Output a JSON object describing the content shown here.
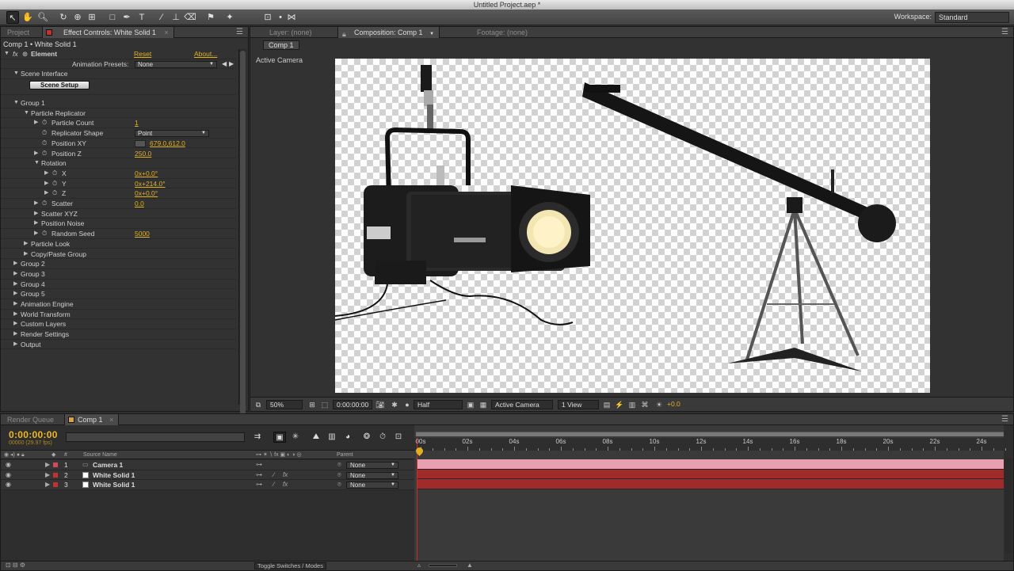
{
  "window": {
    "title": "Untitled Project.aep *"
  },
  "toolbar": {
    "workspace_label": "Workspace:",
    "workspace_value": "Standard"
  },
  "left_panel": {
    "tabs": [
      {
        "label": "Project"
      },
      {
        "label": "Effect Controls: White Solid 1"
      }
    ],
    "subtitle": "Comp 1 • White Solid 1",
    "effect": {
      "fx": "fx",
      "name": "Element",
      "reset": "Reset",
      "about": "About..."
    },
    "animation_presets": {
      "label": "Animation Presets:",
      "value": "None"
    },
    "scene_interface": "Scene Interface",
    "scene_setup": "Scene Setup",
    "tree": [
      {
        "label": "Group 1"
      },
      {
        "label": "Particle Replicator"
      },
      {
        "label": "Particle Count",
        "value": "1"
      },
      {
        "label": "Replicator Shape",
        "value": "Point"
      },
      {
        "label": "Position XY",
        "value": "679.0,612.0"
      },
      {
        "label": "Position Z",
        "value": "250.0"
      },
      {
        "label": "Rotation"
      },
      {
        "label": "X",
        "value": "0x+0.0°"
      },
      {
        "label": "Y",
        "value": "0x+214.0°"
      },
      {
        "label": "Z",
        "value": "0x+0.0°"
      },
      {
        "label": "Scatter",
        "value": "0.0"
      },
      {
        "label": "Scatter XYZ"
      },
      {
        "label": "Position Noise"
      },
      {
        "label": "Random Seed",
        "value": "5000"
      },
      {
        "label": "Particle Look"
      },
      {
        "label": "Copy/Paste Group"
      },
      {
        "label": "Group 2"
      },
      {
        "label": "Group 3"
      },
      {
        "label": "Group 4"
      },
      {
        "label": "Group 5"
      },
      {
        "label": "Animation Engine"
      },
      {
        "label": "World Transform"
      },
      {
        "label": "Custom Layers"
      },
      {
        "label": "Render Settings"
      },
      {
        "label": "Output"
      }
    ]
  },
  "comp_panel": {
    "tabs": [
      {
        "label": "Layer: (none)"
      },
      {
        "label": "Composition: Comp 1"
      },
      {
        "label": "Footage: (none)"
      }
    ],
    "subtab": "Comp 1",
    "view_label": "Active Camera",
    "bottom_bar": {
      "zoom": "50%",
      "timecode": "0:00:00:00",
      "resolution": "Half",
      "camera": "Active Camera",
      "views": "1 View",
      "exposure": "+0.0"
    }
  },
  "timeline": {
    "tabs": [
      {
        "label": "Render Queue"
      },
      {
        "label": "Comp 1"
      }
    ],
    "timecode": "0:00:00:00",
    "fps": "00000 (29.97 fps)",
    "search_placeholder": "",
    "columns": {
      "hash": "#",
      "source_name": "Source Name",
      "parent": "Parent"
    },
    "layers": [
      {
        "num": "1",
        "name": "Camera 1",
        "parent": "None",
        "color": "#e8a0b0",
        "swatch": "#d24a5a"
      },
      {
        "num": "2",
        "name": "White Solid 1",
        "parent": "None",
        "color": "#a12a2a",
        "swatch": "#c83030"
      },
      {
        "num": "3",
        "name": "White Solid 1",
        "parent": "None",
        "color": "#a12a2a",
        "swatch": "#c83030"
      }
    ],
    "ruler": [
      "00s",
      "02s",
      "04s",
      "06s",
      "08s",
      "10s",
      "12s",
      "14s",
      "16s",
      "18s",
      "20s",
      "22s",
      "24s"
    ],
    "footer": "Toggle Switches / Modes"
  }
}
